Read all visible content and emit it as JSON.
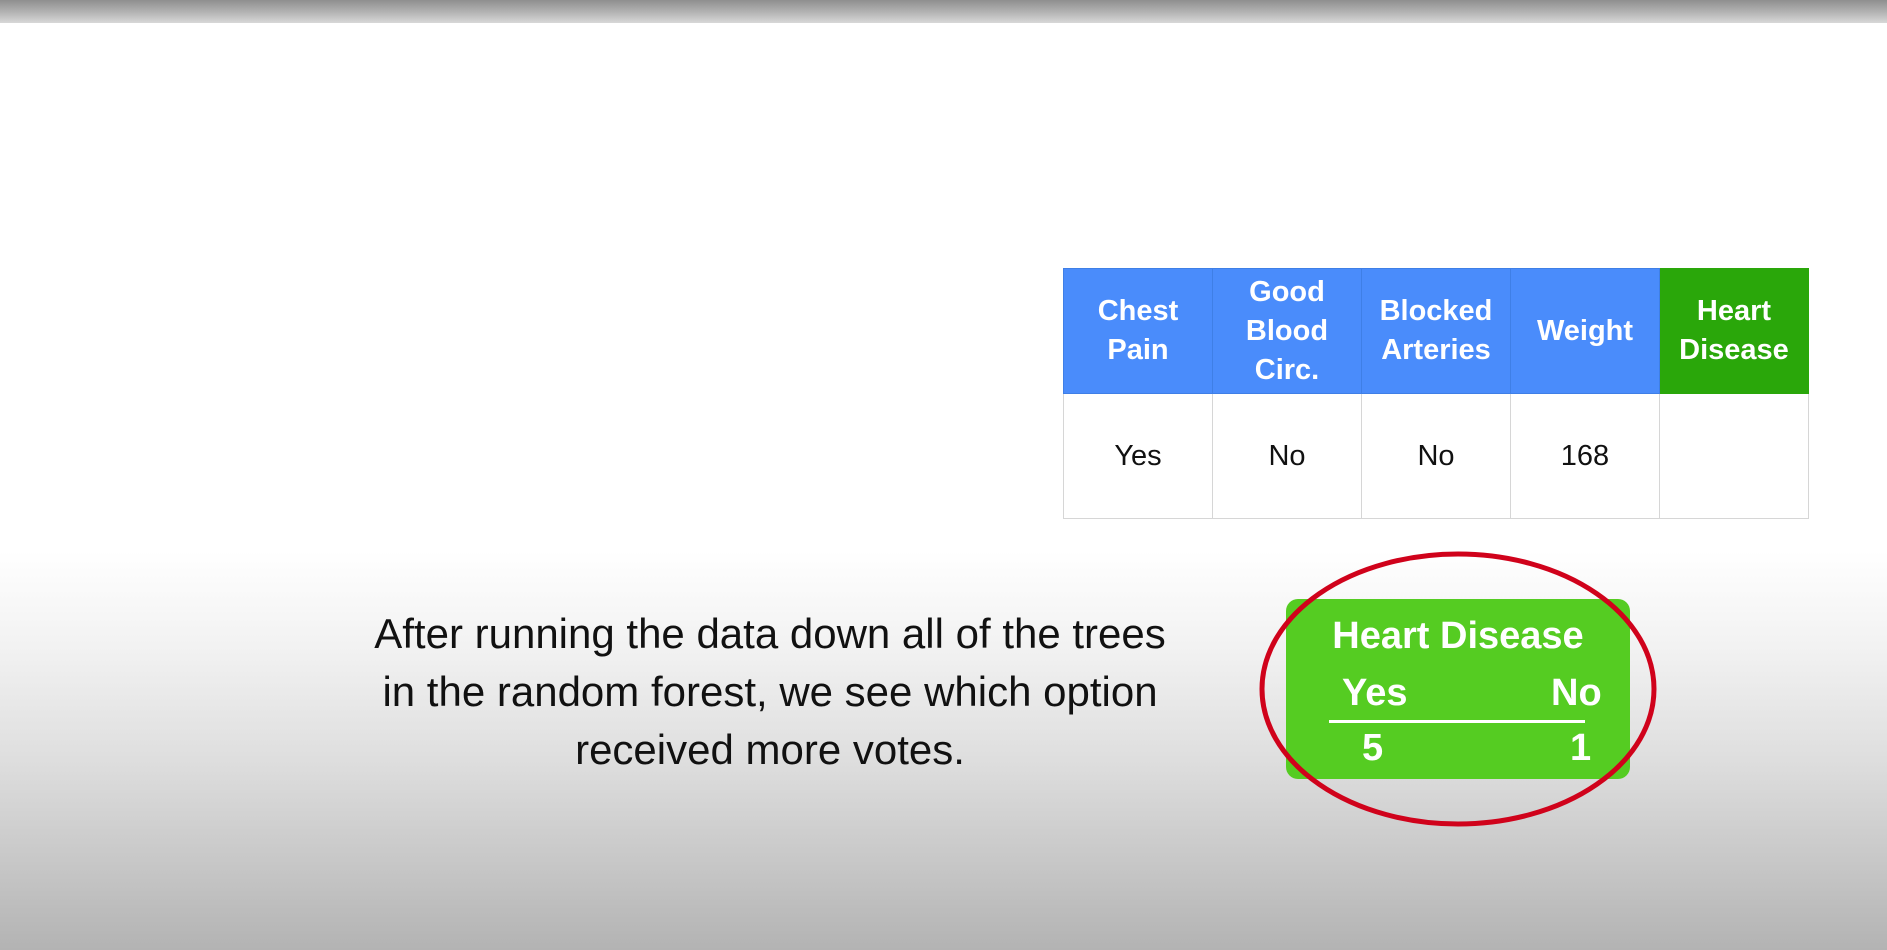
{
  "table": {
    "headers": [
      {
        "label": "Chest Pain"
      },
      {
        "label": "Good Blood Circ."
      },
      {
        "label": "Blocked Arteries"
      },
      {
        "label": "Weight"
      },
      {
        "label": "Heart Disease"
      }
    ],
    "row": [
      "Yes",
      "No",
      "No",
      "168",
      ""
    ]
  },
  "caption": {
    "line1": "After running the data down all of the trees",
    "line2": "in the random forest, we see which option",
    "line3": "received more votes."
  },
  "votes": {
    "title": "Heart Disease",
    "yes_label": "Yes",
    "no_label": "No",
    "yes_count": "5",
    "no_count": "1"
  },
  "colors": {
    "feature_header": "#4a8cfb",
    "target_header": "#2aa70a",
    "vote_box": "#55cc22",
    "highlight": "#d0021b"
  }
}
